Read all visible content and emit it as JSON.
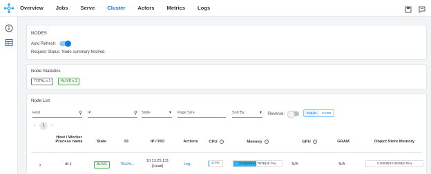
{
  "nav": {
    "items": [
      {
        "label": "Overview"
      },
      {
        "label": "Jobs"
      },
      {
        "label": "Serve"
      },
      {
        "label": "Cluster"
      },
      {
        "label": "Actors"
      },
      {
        "label": "Metrics"
      },
      {
        "label": "Logs"
      }
    ],
    "active": "Cluster"
  },
  "nodes_card": {
    "title": "NODES",
    "auto_refresh_label": "Auto Refresh:",
    "auto_refresh_on": true,
    "request_status": "Request Status: Node summary fetched."
  },
  "stats_card": {
    "title": "Node Statistics",
    "total_chip": "TOTAL x 1",
    "alive_chip": "ALIVE x 1"
  },
  "list_card": {
    "title": "Node List",
    "host_placeholder": "Host",
    "ip_placeholder": "IP",
    "state_placeholder": "State",
    "page_size_placeholder": "Page Size",
    "sort_placeholder": "Sort By",
    "reverse_label": "Reverse:",
    "view_table": "TABLE",
    "view_card": "CARD",
    "current_page": "1",
    "columns": {
      "host": "Host / Worker Process name",
      "state": "State",
      "id": "ID",
      "ip": "IP / PID",
      "actions": "Actions",
      "cpu": "CPU",
      "memory": "Memory",
      "gpu": "GPU",
      "gram": "GRAM",
      "object_store": "Object Store Memory"
    },
    "row": {
      "host": "df-1",
      "state": "ALIVE",
      "id": "76a7b...",
      "ip": "10.13.25.131",
      "pid": "(Head)",
      "action": "Log",
      "cpu": "0.7%",
      "memory": "29.35GB/62.79GB(46.7%)",
      "memory_fraction": 0.467,
      "cpu_fraction": 0.007,
      "gpu": "N/A",
      "gram": "N/A",
      "object_store": "0.0000B/10.05GB(0.0%)"
    }
  },
  "colors": {
    "accent": "#1976d2",
    "alive": "#4caf50",
    "memory_bar": "#29b6f6"
  }
}
